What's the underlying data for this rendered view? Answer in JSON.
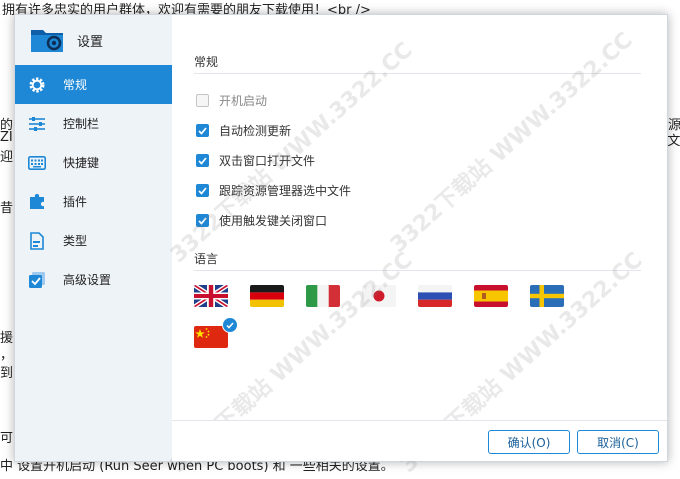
{
  "background": {
    "top_line": "拥有许多忠实的用户群体，欢迎有需要的朋友下载使用！<br />",
    "left_fragments": [
      "的",
      "ZI",
      "迎",
      "昔",
      "援",
      "，",
      "到",
      "可",
      "中"
    ],
    "right_fragments": [
      "源",
      "r文"
    ],
    "bottom_line": "中 设置开机启动 (Run Seer when PC boots) 和 一些相关的设置。"
  },
  "dialog": {
    "title": "设置",
    "nav": [
      {
        "label": "常规",
        "icon": "gear-icon",
        "active": true
      },
      {
        "label": "控制栏",
        "icon": "sliders-icon",
        "active": false
      },
      {
        "label": "快捷键",
        "icon": "keyboard-icon",
        "active": false
      },
      {
        "label": "插件",
        "icon": "puzzle-icon",
        "active": false
      },
      {
        "label": "类型",
        "icon": "file-type-icon",
        "active": false
      },
      {
        "label": "高级设置",
        "icon": "advanced-icon",
        "active": false
      }
    ],
    "general": {
      "section_title": "常规",
      "options": [
        {
          "label": "开机启动",
          "checked": false,
          "enabled": false
        },
        {
          "label": "自动检测更新",
          "checked": true,
          "enabled": true
        },
        {
          "label": "双击窗口打开文件",
          "checked": true,
          "enabled": true
        },
        {
          "label": "跟踪资源管理器选中文件",
          "checked": true,
          "enabled": true
        },
        {
          "label": "使用触发键关闭窗口",
          "checked": true,
          "enabled": true
        }
      ]
    },
    "language": {
      "section_title": "语言",
      "flags": [
        "uk-flag-icon",
        "germany-flag-icon",
        "italy-flag-icon",
        "japan-flag-icon",
        "russia-flag-icon",
        "spain-flag-icon",
        "sweden-flag-icon",
        "china-flag-icon"
      ],
      "selected": "china-flag-icon"
    },
    "buttons": {
      "ok": "确认(O)",
      "cancel": "取消(C)"
    }
  },
  "watermark": "3322下载站 WWW.3322.CC",
  "colors": {
    "accent": "#1e88d6",
    "sidebar_bg": "#eef3f8"
  }
}
